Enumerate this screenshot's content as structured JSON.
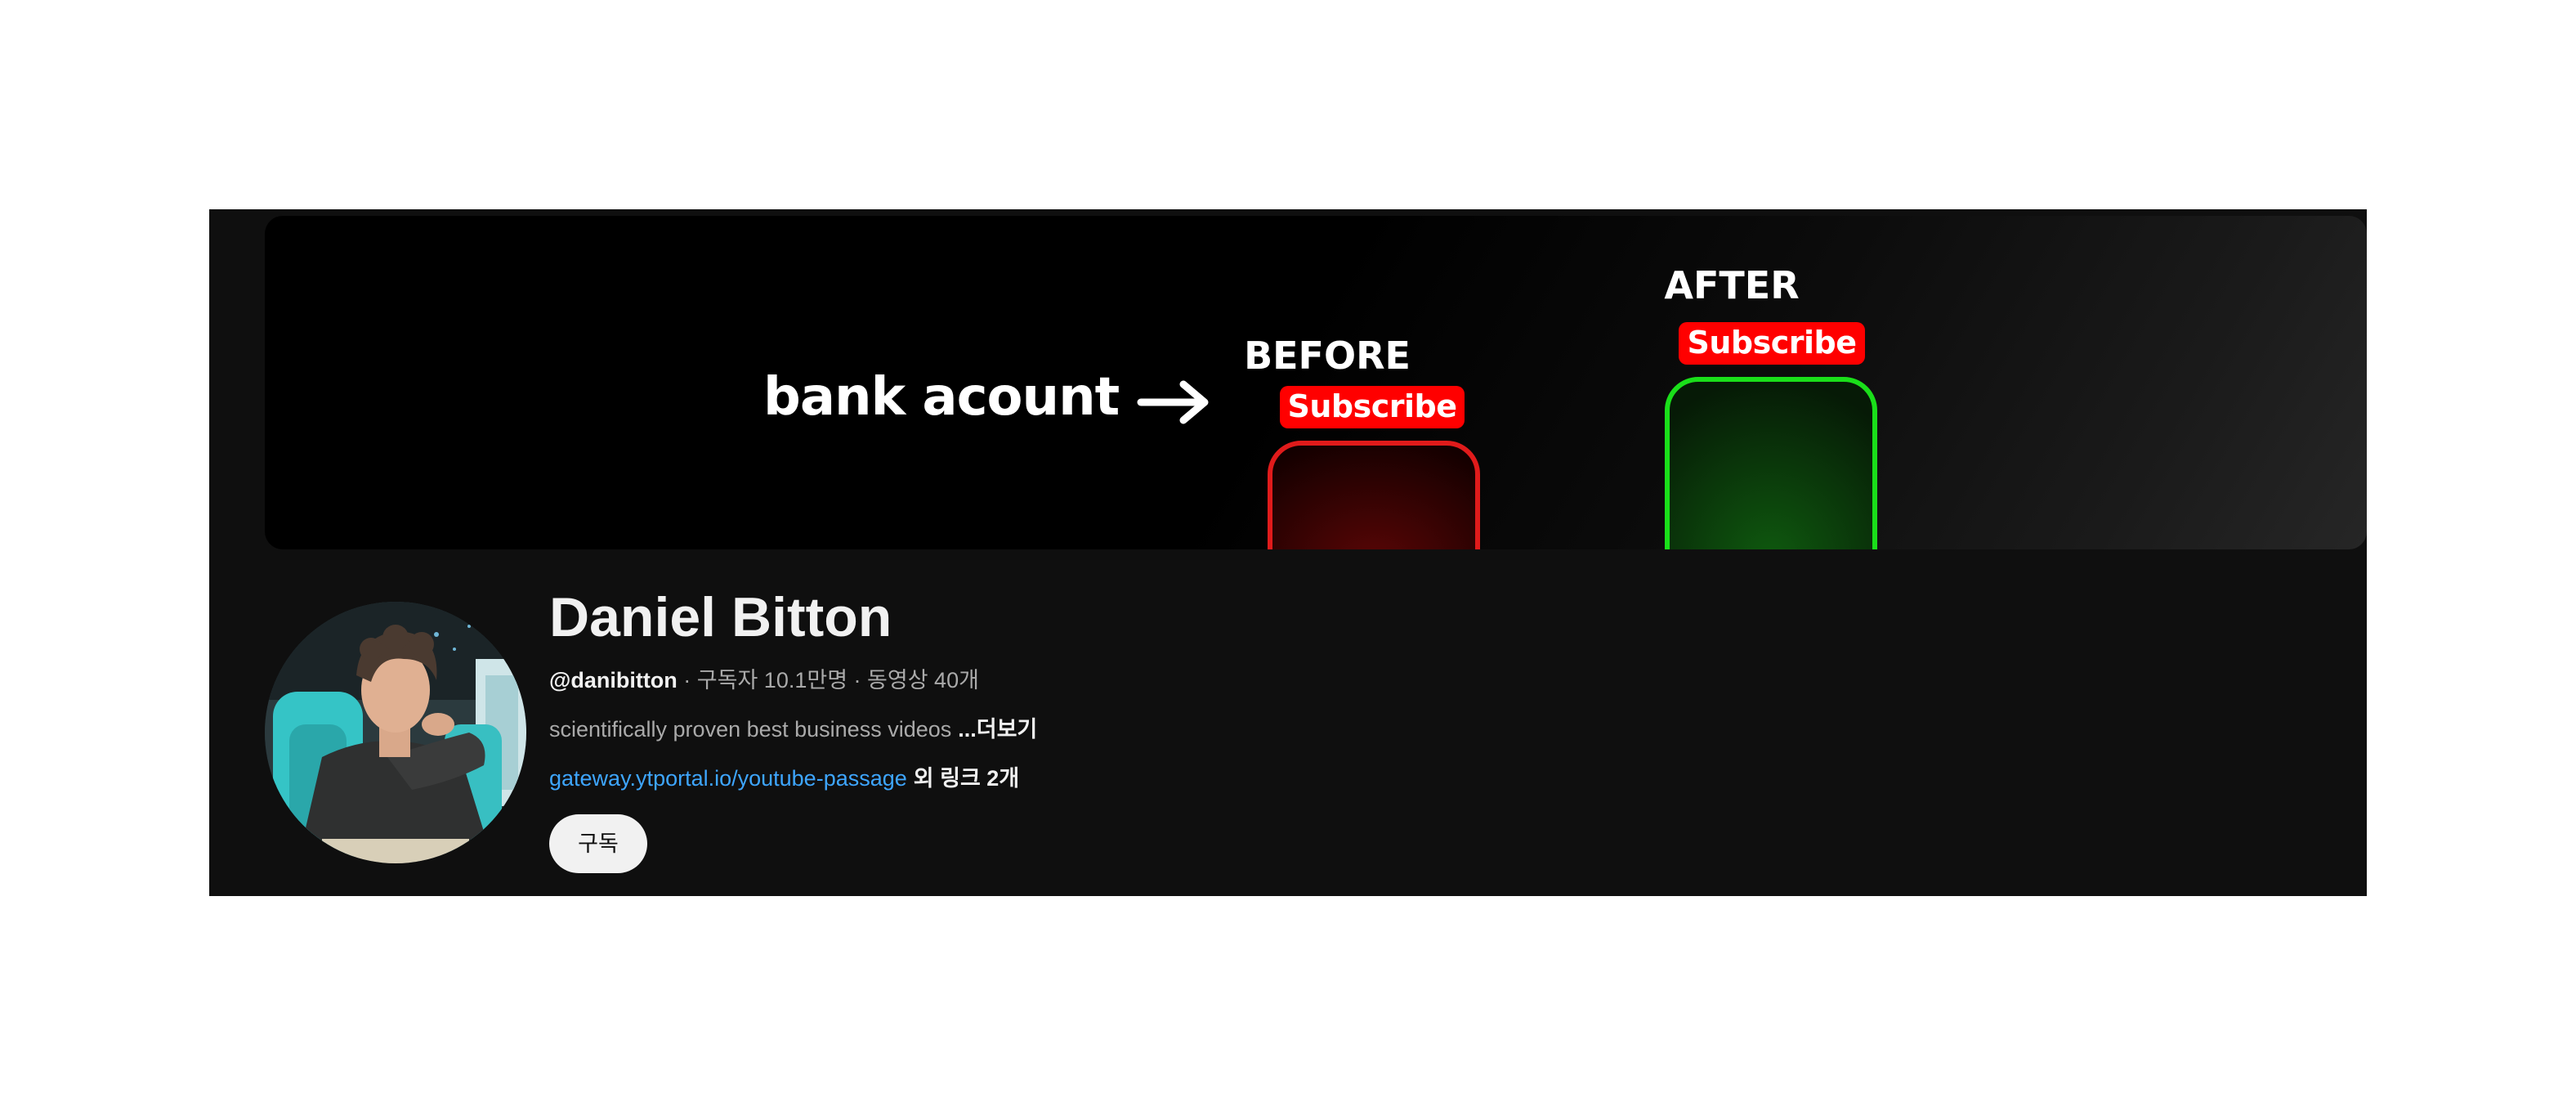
{
  "banner": {
    "left_text": "bank acount",
    "arrow": "right-arrow",
    "before_label": "BEFORE",
    "after_label": "AFTER",
    "before_subscribe": "Subscribe",
    "after_subscribe": "Subscribe",
    "before_color": "#e01b1b",
    "after_color": "#1adf1a"
  },
  "channel": {
    "name": "Daniel Bitton",
    "handle": "@danibitton",
    "stats": " · 구독자 10.1만명 · 동영상 40개",
    "description": "scientifically proven best business videos",
    "more_label": "...더보기",
    "link": "gateway.ytportal.io/youtube-passage",
    "more_links": "외 링크 2개",
    "subscribe_label": "구독"
  },
  "colors": {
    "background": "#0f0f0f",
    "link": "#3ea6ff",
    "subscribe_red": "#ff0000"
  }
}
